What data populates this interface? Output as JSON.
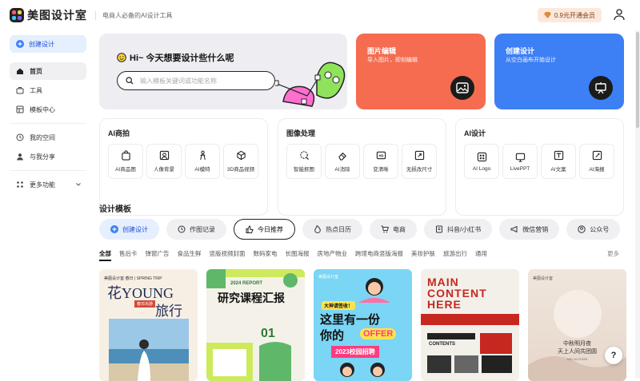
{
  "header": {
    "app_name": "美图设计室",
    "slogan": "电商人必备的AI设计工具",
    "vip_label": "0.9元开通会员"
  },
  "sidebar": {
    "create_label": "创建设计",
    "items": [
      {
        "label": "首页",
        "icon": "home-icon",
        "active": true
      },
      {
        "label": "工具",
        "icon": "toolbox-icon"
      },
      {
        "label": "模板中心",
        "icon": "template-icon"
      },
      {
        "label": "我的空间",
        "icon": "clock-icon"
      },
      {
        "label": "与我分享",
        "icon": "person-icon"
      },
      {
        "label": "更多功能",
        "icon": "grid-icon"
      }
    ]
  },
  "hero": {
    "greeting": "Hi~ 今天想要设计些什么呢",
    "search_placeholder": "输入模板关键词或功能名称"
  },
  "cards": {
    "edit": {
      "title": "图片编辑",
      "subtitle": "导入图片，即刻编辑",
      "color": "#f56c50"
    },
    "design": {
      "title": "创建设计",
      "subtitle": "从空白画布开始设计",
      "color": "#3d7ff5"
    }
  },
  "sections": [
    {
      "title": "AI商拍",
      "tools": [
        {
          "label": "AI商品图",
          "icon": "shopping-bag-icon"
        },
        {
          "label": "人像背景",
          "icon": "portrait-icon"
        },
        {
          "label": "AI模特",
          "icon": "model-icon"
        },
        {
          "label": "3D商品视频",
          "icon": "cube-icon"
        }
      ]
    },
    {
      "title": "图像处理",
      "tools": [
        {
          "label": "智能抠图",
          "icon": "cutout-icon"
        },
        {
          "label": "AI消除",
          "icon": "eraser-icon"
        },
        {
          "label": "变清晰",
          "icon": "hd-icon"
        },
        {
          "label": "无损改尺寸",
          "icon": "resize-icon"
        }
      ]
    },
    {
      "title": "AI设计",
      "tools": [
        {
          "label": "AI Logo",
          "icon": "logo-icon"
        },
        {
          "label": "LivePPT",
          "icon": "slides-icon"
        },
        {
          "label": "AI文案",
          "icon": "text-icon"
        },
        {
          "label": "AI海报",
          "icon": "poster-icon"
        }
      ]
    }
  ],
  "templates": {
    "title": "设计模板",
    "pills": [
      "创建设计",
      "作图记录",
      "今日推荐",
      "热点日历",
      "电商",
      "抖音/小红书",
      "微信营销",
      "公众号"
    ],
    "categories": [
      "全部",
      "售后卡",
      "弹窗广告",
      "食品生鲜",
      "竖版视频封面",
      "数码家电",
      "长图海报",
      "房地产物业",
      "跨境电商竖版海报",
      "美妆护肤",
      "旅游出行",
      "通用"
    ],
    "more_label": "更多",
    "thumbs": [
      {
        "brand": "美图设计室·春日 | SPRING TRIP",
        "title_top": "花YOUNG",
        "title_bottom": "旅行",
        "tag": "春日出游"
      },
      {
        "badge": "2024 REPORT",
        "title": "研究课程汇报",
        "number": "01"
      },
      {
        "brand": "美图设计室",
        "headline_1": "这里有一份",
        "headline_2": "你的",
        "offer": "OFFER",
        "banner": "2023校园招聘",
        "tag": "大神请签收！"
      },
      {
        "line1": "MAIN",
        "line2": "CONTENT",
        "line3": "HERE",
        "sub": "CONTENTS"
      },
      {
        "brand": "美图设计室",
        "line1": "中秋明月夜",
        "line2": "天上人间共团圆",
        "sub": "MID-AUTUMN"
      }
    ]
  },
  "help_label": "?"
}
